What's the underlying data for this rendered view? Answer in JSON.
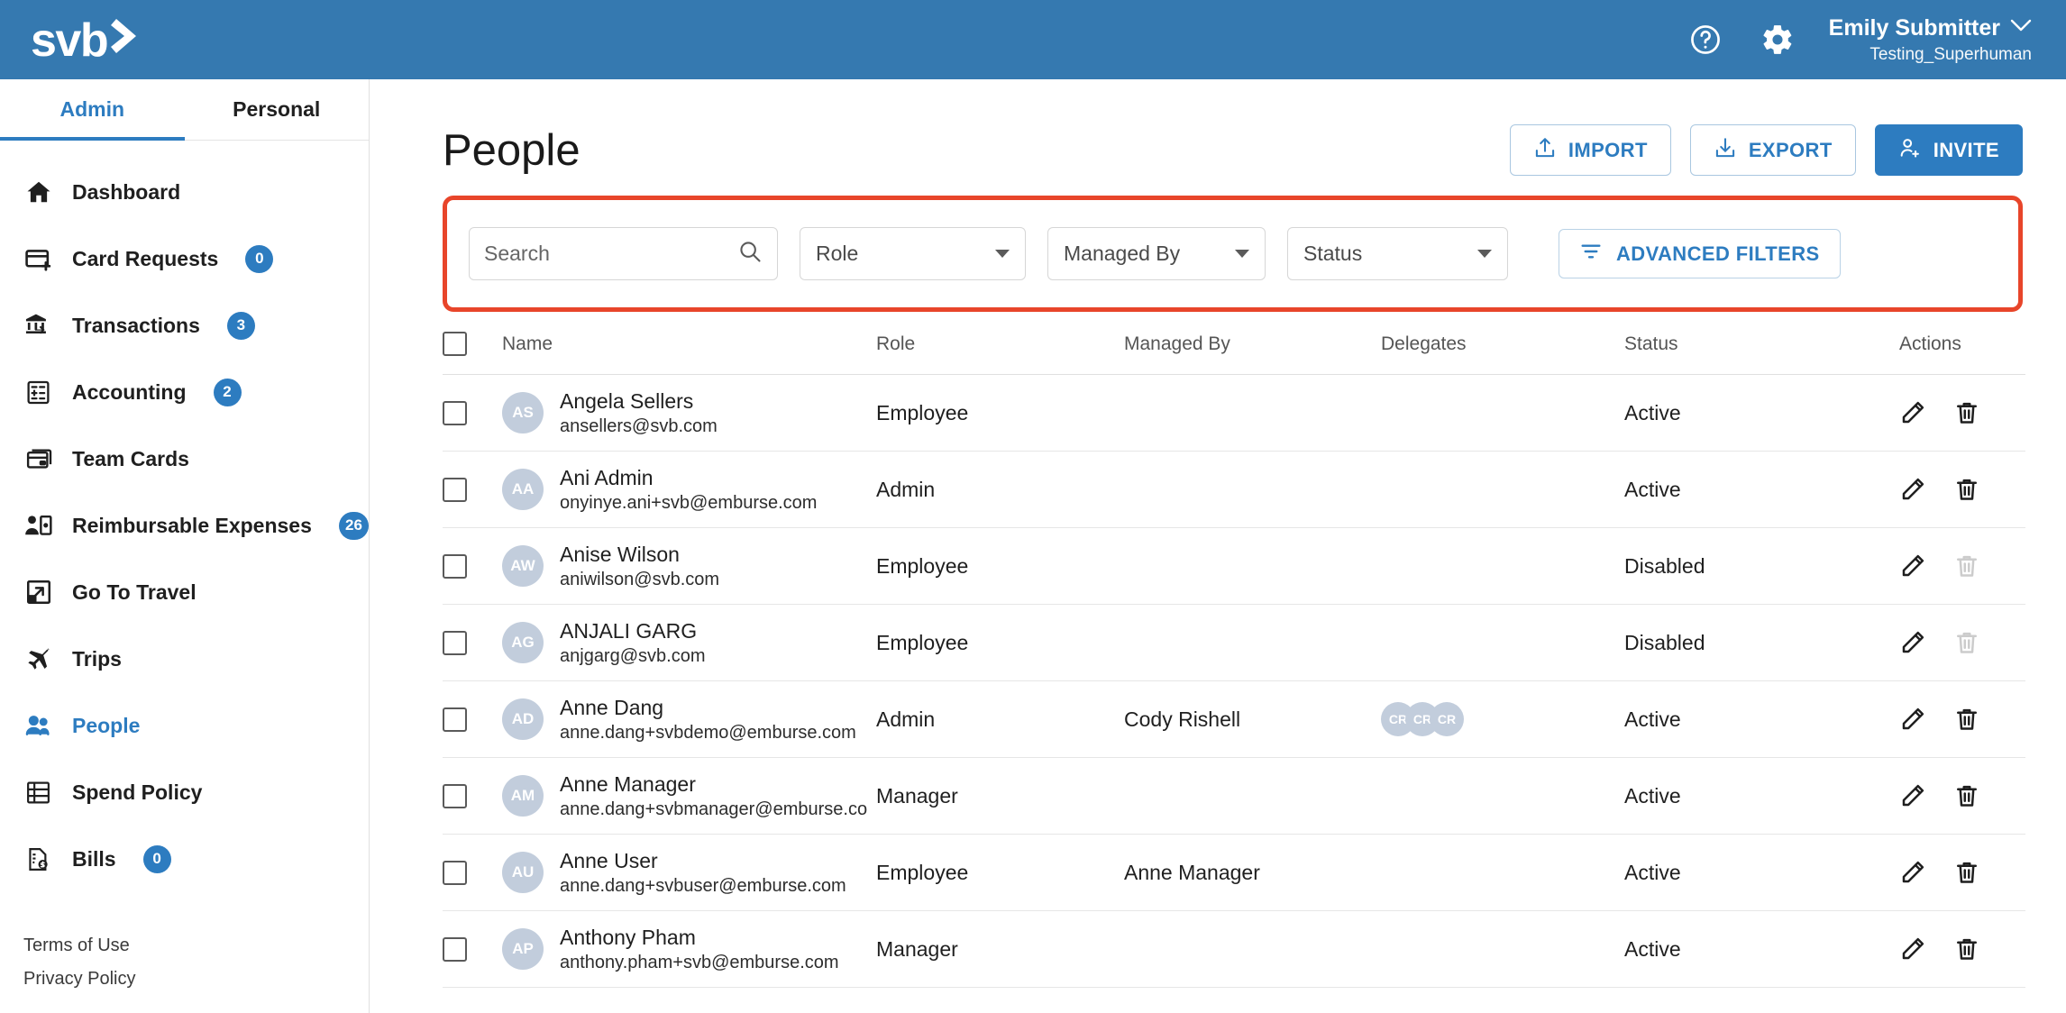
{
  "topbar": {
    "logo_text": "svb",
    "help_icon": "help-circle-icon",
    "settings_icon": "gear-icon",
    "user_name": "Emily Submitter",
    "user_org": "Testing_Superhuman",
    "brand_color": "#3579b0"
  },
  "sidebar": {
    "tabs": [
      {
        "label": "Admin",
        "active": true
      },
      {
        "label": "Personal",
        "active": false
      }
    ],
    "items": [
      {
        "label": "Dashboard",
        "icon": "home-icon",
        "badge": null,
        "active": false
      },
      {
        "label": "Card Requests",
        "icon": "card-plus-icon",
        "badge": "0",
        "active": false
      },
      {
        "label": "Transactions",
        "icon": "bank-transfer-icon",
        "badge": "3",
        "active": false
      },
      {
        "label": "Accounting",
        "icon": "calculator-icon",
        "badge": "2",
        "active": false
      },
      {
        "label": "Team Cards",
        "icon": "cards-stack-icon",
        "badge": null,
        "active": false
      },
      {
        "label": "Reimbursable Expenses",
        "icon": "person-money-icon",
        "badge": "26",
        "active": false
      },
      {
        "label": "Go To Travel",
        "icon": "external-link-icon",
        "badge": null,
        "active": false
      },
      {
        "label": "Trips",
        "icon": "airplane-icon",
        "badge": null,
        "active": false
      },
      {
        "label": "People",
        "icon": "people-icon",
        "badge": null,
        "active": true
      },
      {
        "label": "Spend Policy",
        "icon": "list-rows-icon",
        "badge": null,
        "active": false
      },
      {
        "label": "Bills",
        "icon": "document-dollar-icon",
        "badge": "0",
        "active": false
      }
    ],
    "footer": [
      {
        "label": "Terms of Use"
      },
      {
        "label": "Privacy Policy"
      }
    ],
    "accent_color": "#2d7cc0"
  },
  "page": {
    "title": "People",
    "buttons": [
      {
        "label": "IMPORT",
        "icon": "upload-icon",
        "style": "outline"
      },
      {
        "label": "EXPORT",
        "icon": "download-icon",
        "style": "outline"
      },
      {
        "label": "INVITE",
        "icon": "person-add-icon",
        "style": "primary"
      }
    ]
  },
  "filters": {
    "highlight_color": "#e8452a",
    "search": {
      "value": "",
      "placeholder": "Search",
      "icon": "search-icon"
    },
    "selects": [
      {
        "name": "role",
        "label": "Role"
      },
      {
        "name": "managed_by",
        "label": "Managed By"
      },
      {
        "name": "status",
        "label": "Status"
      }
    ],
    "advanced_filters": {
      "label": "ADVANCED FILTERS",
      "icon": "filter-icon"
    }
  },
  "table": {
    "columns": [
      "Name",
      "Role",
      "Managed By",
      "Delegates",
      "Status",
      "Actions"
    ],
    "select_all_checked": false,
    "rows": [
      {
        "checked": false,
        "initials": "AS",
        "name": "Angela Sellers",
        "email": "ansellers@svb.com",
        "role": "Employee",
        "managed_by": "",
        "delegates": [],
        "status": "Active",
        "delete_enabled": true
      },
      {
        "checked": false,
        "initials": "AA",
        "name": "Ani Admin",
        "email": "onyinye.ani+svb@emburse.com",
        "role": "Admin",
        "managed_by": "",
        "delegates": [],
        "status": "Active",
        "delete_enabled": true
      },
      {
        "checked": false,
        "initials": "AW",
        "name": "Anise Wilson",
        "email": "aniwilson@svb.com",
        "role": "Employee",
        "managed_by": "",
        "delegates": [],
        "status": "Disabled",
        "delete_enabled": false
      },
      {
        "checked": false,
        "initials": "AG",
        "name": "ANJALI GARG",
        "email": "anjgarg@svb.com",
        "role": "Employee",
        "managed_by": "",
        "delegates": [],
        "status": "Disabled",
        "delete_enabled": false
      },
      {
        "checked": false,
        "initials": "AD",
        "name": "Anne Dang",
        "email": "anne.dang+svbdemo@emburse.com",
        "role": "Admin",
        "managed_by": "Cody Rishell",
        "delegates": [
          "CR",
          "CR",
          "CR"
        ],
        "status": "Active",
        "delete_enabled": true
      },
      {
        "checked": false,
        "initials": "AM",
        "name": "Anne Manager",
        "email": "anne.dang+svbmanager@emburse.co",
        "role": "Manager",
        "managed_by": "",
        "delegates": [],
        "status": "Active",
        "delete_enabled": true
      },
      {
        "checked": false,
        "initials": "AU",
        "name": "Anne User",
        "email": "anne.dang+svbuser@emburse.com",
        "role": "Employee",
        "managed_by": "Anne Manager",
        "delegates": [],
        "status": "Active",
        "delete_enabled": true
      },
      {
        "checked": false,
        "initials": "AP",
        "name": "Anthony Pham",
        "email": "anthony.pham+svb@emburse.com",
        "role": "Manager",
        "managed_by": "",
        "delegates": [],
        "status": "Active",
        "delete_enabled": true
      }
    ],
    "action_icons": {
      "edit": "pencil-icon",
      "delete": "trash-icon"
    }
  }
}
